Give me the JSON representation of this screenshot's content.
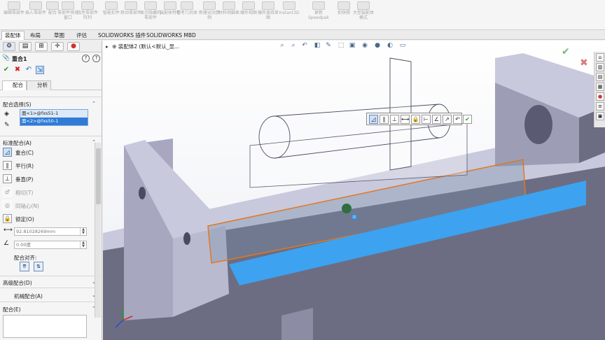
{
  "ribbon": {
    "buttons": [
      {
        "label": "编辑零部件",
        "icon": "edit-component-icon"
      },
      {
        "label": "插入零部件",
        "icon": "insert-component-icon"
      },
      {
        "label": "配合",
        "icon": "mate-icon"
      },
      {
        "label": "零部件预览窗口",
        "icon": "component-preview-icon"
      },
      {
        "label": "线性零部件阵列",
        "icon": "linear-pattern-icon"
      },
      {
        "label": "智能扣件",
        "icon": "smart-fastener-icon"
      },
      {
        "label": "移动零部件",
        "icon": "move-component-icon"
      },
      {
        "label": "显示隐藏的零部件",
        "icon": "show-hidden-icon"
      },
      {
        "label": "装配体特征",
        "icon": "assembly-feature-icon"
      },
      {
        "label": "参考几何体",
        "icon": "reference-geometry-icon"
      },
      {
        "label": "新建运动算例",
        "icon": "motion-study-icon"
      },
      {
        "label": "材料明细表",
        "icon": "bom-icon"
      },
      {
        "label": "爆炸视图",
        "icon": "exploded-view-icon"
      },
      {
        "label": "爆炸直线草图",
        "icon": "explode-line-sketch-icon"
      },
      {
        "label": "Instant3D",
        "icon": "instant3d-icon"
      },
      {
        "label": "更新Speedpak",
        "icon": "speedpak-icon"
      },
      {
        "label": "拍快照",
        "icon": "snapshot-icon"
      },
      {
        "label": "大型装配体模式",
        "icon": "large-assembly-icon"
      }
    ]
  },
  "cm_tabs": [
    "装配体",
    "布局",
    "草图",
    "评估",
    "SOLIDWORKS 插件",
    "SOLIDWORKS MBD"
  ],
  "property_manager": {
    "title": "重合1",
    "tabs": {
      "mate": "配合",
      "analysis": "分析"
    },
    "mate_selections": {
      "title": "配合选择(S)",
      "items": [
        "面<1>@fxs51-1",
        "面<2>@fxs50-1"
      ]
    },
    "standard_mates": {
      "title": "标准配合(A)",
      "options": [
        {
          "label": "重合(C)",
          "icon": "coincident-icon"
        },
        {
          "label": "平行(R)",
          "icon": "parallel-icon"
        },
        {
          "label": "垂直(P)",
          "icon": "perpendicular-icon"
        },
        {
          "label": "相切(T)",
          "icon": "tangent-icon"
        },
        {
          "label": "同轴心(N)",
          "icon": "concentric-icon"
        },
        {
          "label": "锁定(O)",
          "icon": "lock-icon"
        }
      ],
      "distance_value": "92.81028269mm",
      "angle_value": "0.00度",
      "alignment_label": "配合对齐:"
    },
    "advanced": "高级配合(D)",
    "mechanical": "机械配合(A)",
    "comment": "配合(E)"
  },
  "viewport": {
    "breadcrumb": "装配体2 (默认<默认_显..."
  },
  "colors": {
    "accent": "#2f7bd6",
    "highlight_face": "#3da2f0",
    "body": "#c8c9dc",
    "body_dark": "#6c6d83",
    "selection_outline": "#e07820",
    "ok": "#7ab67a",
    "cancel": "#d97a7a"
  }
}
